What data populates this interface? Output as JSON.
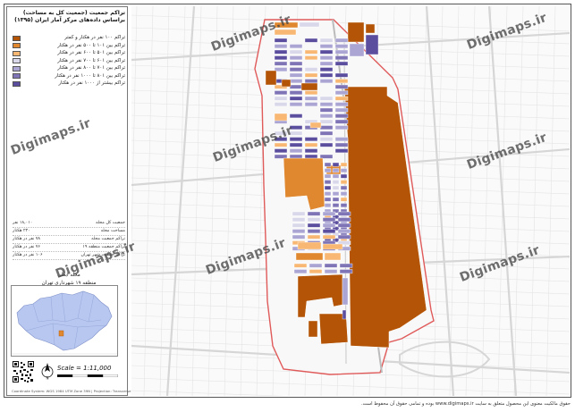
{
  "panel": {
    "title": "تراکم جمعیت (جمعیت کل به مساحت) براساس داده‌های مرکز آمار ایران (۱۳۹۵)",
    "legend": [
      {
        "label": "تراکم ۱۰۰ نفر در هکتار و کمتر",
        "color": "#b35406"
      },
      {
        "label": "تراکم بین ۱۰۱ تا ۵۰۰ نفر در هکتار",
        "color": "#e0882f"
      },
      {
        "label": "تراکم بین ۵۰۱ تا ۶۰۰ نفر در هکتار",
        "color": "#f8b773"
      },
      {
        "label": "تراکم بین ۶۰۱ تا ۷۰۰ نفر در هکتار",
        "color": "#d9d7ea"
      },
      {
        "label": "تراکم بین ۷۰۱ تا ۸۰۰ نفر در هکتار",
        "color": "#aaa5d3"
      },
      {
        "label": "تراکم بین ۸۰۱ تا ۱۰۰۰ نفر در هکتار",
        "color": "#7f74b5"
      },
      {
        "label": "تراکم بیشتر از ۱۰۰۰ نفر در هکتار",
        "color": "#5b4e9e"
      }
    ],
    "stats": [
      {
        "label": "جمعیت کل محله",
        "value": "۱۸,۰۱۰ نفر"
      },
      {
        "label": "مساحت محله",
        "value": "۲۳۰ هکتار"
      },
      {
        "label": "تراکم جمعیت محله",
        "value": "۷۸ نفر در هکتار"
      },
      {
        "label": "تراکم جمعیت منطقه ۱۹",
        "value": "۷۶ نفر در هکتار"
      },
      {
        "label": "تراکم جمعیت شهر تهران",
        "value": "۱۰۶ نفر در هکتار"
      }
    ],
    "district_line1": "محله ابعلی",
    "district_line2": "منطقه ۱۹ شهرداری تهران",
    "scale": "Scale = 1:11,000",
    "footer_note": "Coordinate System: WGS 1984 UTM Zone 39N  |  Projection: Transverse Mercator"
  },
  "watermark": "Digimaps.ir",
  "copyright": "حقوق مالکیت معنوی این محصول متعلق به سایت www.digimaps.ir بوده و تمامی حقوق آن محفوظ است.",
  "colors": {
    "road": "#d6d6d6",
    "road_minor": "#e4e4e4",
    "boundary": "#e05a5a",
    "bg_block": "#f4f4f4"
  }
}
